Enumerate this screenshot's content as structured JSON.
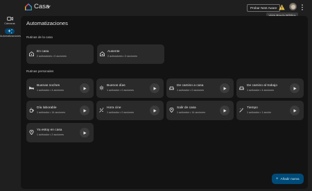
{
  "app": {
    "title": "Casa"
  },
  "header": {
    "nest_aware_label": "Probar Nest Aware",
    "tooltip": "Vista Previa Pública"
  },
  "nav": [
    {
      "label": "Cámaras",
      "icon": "camera-icon",
      "active": false
    },
    {
      "label": "Automatizaciones",
      "icon": "automations-icon",
      "active": true
    }
  ],
  "page": {
    "title": "Automatizaciones"
  },
  "household": {
    "title": "Rutinas de la casa",
    "cards": [
      {
        "name": "En casa",
        "sub": "2 activadores • 0 acciones",
        "icon": "home-icon"
      },
      {
        "name": "Ausente",
        "sub": "2 activadores • 0 acciones",
        "icon": "away-icon"
      }
    ]
  },
  "personal": {
    "title": "Rutinas personales",
    "cards": [
      {
        "name": "Buenas noches",
        "sub": "1 activador • 4 acciones",
        "icon": "bed-icon"
      },
      {
        "name": "Buenos días",
        "sub": "1 activador • 0 acciones",
        "icon": "sun-icon"
      },
      {
        "name": "De camino a casa",
        "sub": "1 activador • 0 acciones",
        "icon": "car-icon"
      },
      {
        "name": "De camino al trabajo",
        "sub": "1 activador • 4 acciones",
        "icon": "car-icon"
      },
      {
        "name": "Día laborable",
        "sub": "1 activador • 14 acciones",
        "icon": "coffee-icon"
      },
      {
        "name": "Hora cine",
        "sub": "1 activador • 0 acciones",
        "icon": "movie-icon"
      },
      {
        "name": "Salir de casa",
        "sub": "1 activador • 14 acciones",
        "icon": "location-icon"
      },
      {
        "name": "Tiempo",
        "sub": "1 activador • 1 acción",
        "icon": "magic-icon"
      },
      {
        "name": "Ya estoy en casa",
        "sub": "1 activador • 2 acciones",
        "icon": "location-icon"
      }
    ]
  },
  "fab": {
    "label": "Añadir nueva"
  },
  "colors": {
    "accent": "#004a77",
    "card": "#2a2a2a",
    "background": "#131313",
    "warning": "#e8c34a"
  }
}
